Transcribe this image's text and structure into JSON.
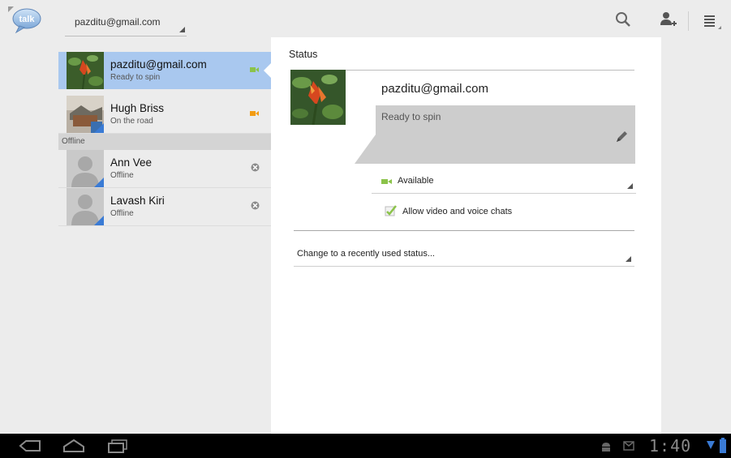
{
  "app": {
    "logo_text": "talk"
  },
  "actionbar": {
    "account": "pazditu@gmail.com",
    "icons": [
      "search-icon",
      "add-contact-icon",
      "overflow-menu-icon"
    ]
  },
  "contacts": [
    {
      "name": "pazditu@gmail.com",
      "status": "Ready to spin",
      "status_icon": "video-icon",
      "status_color": "#8bc34a",
      "selected": true
    },
    {
      "name": "Hugh Briss",
      "status": "On the road",
      "status_icon": "video-icon",
      "status_color": "#f39c12"
    }
  ],
  "offline_section": {
    "header": "Offline",
    "contacts": [
      {
        "name": "Ann Vee",
        "status": "Offline",
        "status_icon": "offline-icon"
      },
      {
        "name": "Lavash Kiri",
        "status": "Offline",
        "status_icon": "offline-icon"
      }
    ]
  },
  "status_panel": {
    "title": "Status",
    "name": "pazditu@gmail.com",
    "message": "Ready to spin",
    "availability": "Available",
    "availability_color": "#8bc34a",
    "allow_video_label": "Allow video and voice chats",
    "allow_video_checked": true,
    "recent_status_label": "Change to a recently used status..."
  },
  "systembar": {
    "time": "1:40",
    "icons": [
      "back-icon",
      "home-icon",
      "recent-apps-icon",
      "android-icon",
      "gmail-icon",
      "wifi-icon",
      "battery-icon"
    ]
  }
}
